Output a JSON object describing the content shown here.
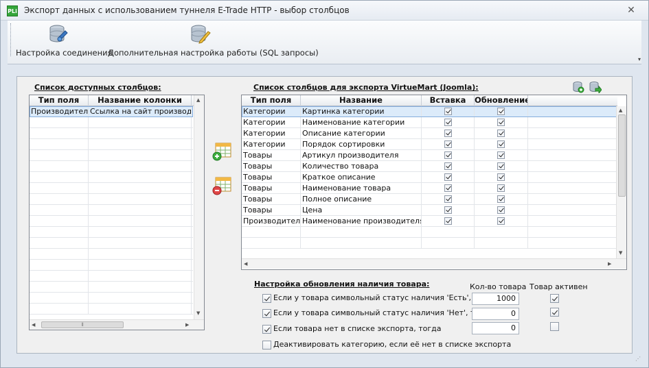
{
  "window": {
    "title": "Экспорт данных с использованием туннеля E-Trade HTTP - выбор столбцов",
    "app_icon_text": "PLi"
  },
  "toolbar": {
    "connection_label": "Настройка соединения",
    "sql_label": "Дополнительная настройка работы (SQL запросы)"
  },
  "available": {
    "title": "Список доступных столбцов:",
    "headers": [
      "Тип поля",
      "Название колонки"
    ],
    "rows": [
      [
        "Производители",
        "Ссылка на сайт производите"
      ]
    ]
  },
  "export": {
    "title": "Список столбцов для экспорта VirtueMart (Joomla):",
    "headers": [
      "Тип поля",
      "Название",
      "Вставка",
      "Обновление"
    ],
    "rows": [
      {
        "type": "Категории",
        "name": "Картинка категории",
        "insert": true,
        "update": true
      },
      {
        "type": "Категории",
        "name": "Наименование категории",
        "insert": true,
        "update": true
      },
      {
        "type": "Категории",
        "name": "Описание категории",
        "insert": true,
        "update": true
      },
      {
        "type": "Категории",
        "name": "Порядок сортировки",
        "insert": true,
        "update": true
      },
      {
        "type": "Товары",
        "name": "Артикул производителя",
        "insert": true,
        "update": true
      },
      {
        "type": "Товары",
        "name": "Количество товара",
        "insert": true,
        "update": true
      },
      {
        "type": "Товары",
        "name": "Краткое описание",
        "insert": true,
        "update": true
      },
      {
        "type": "Товары",
        "name": "Наименование товара",
        "insert": true,
        "update": true
      },
      {
        "type": "Товары",
        "name": "Полное описание",
        "insert": true,
        "update": true
      },
      {
        "type": "Товары",
        "name": "Цена",
        "insert": true,
        "update": true
      },
      {
        "type": "Производители",
        "name": "Наименование производителя",
        "insert": true,
        "update": true
      }
    ]
  },
  "stock": {
    "title": "Настройка обновления наличия товара:",
    "qty_header": "Кол-во товара",
    "active_header": "Товар активен",
    "options": [
      {
        "label": "Если у товара символьный статус наличия 'Есть', тогда",
        "checked": true,
        "qty": "1000",
        "active": true
      },
      {
        "label": "Если у товара символьный статус наличия 'Нет', тогда",
        "checked": true,
        "qty": "0",
        "active": true
      },
      {
        "label": "Если товара нет в списке экспорта, тогда",
        "checked": true,
        "qty": "0",
        "active": false
      }
    ],
    "deactivate_label": "Деактивировать категорию, если её нет в списке экспорта",
    "deactivate_checked": false
  }
}
